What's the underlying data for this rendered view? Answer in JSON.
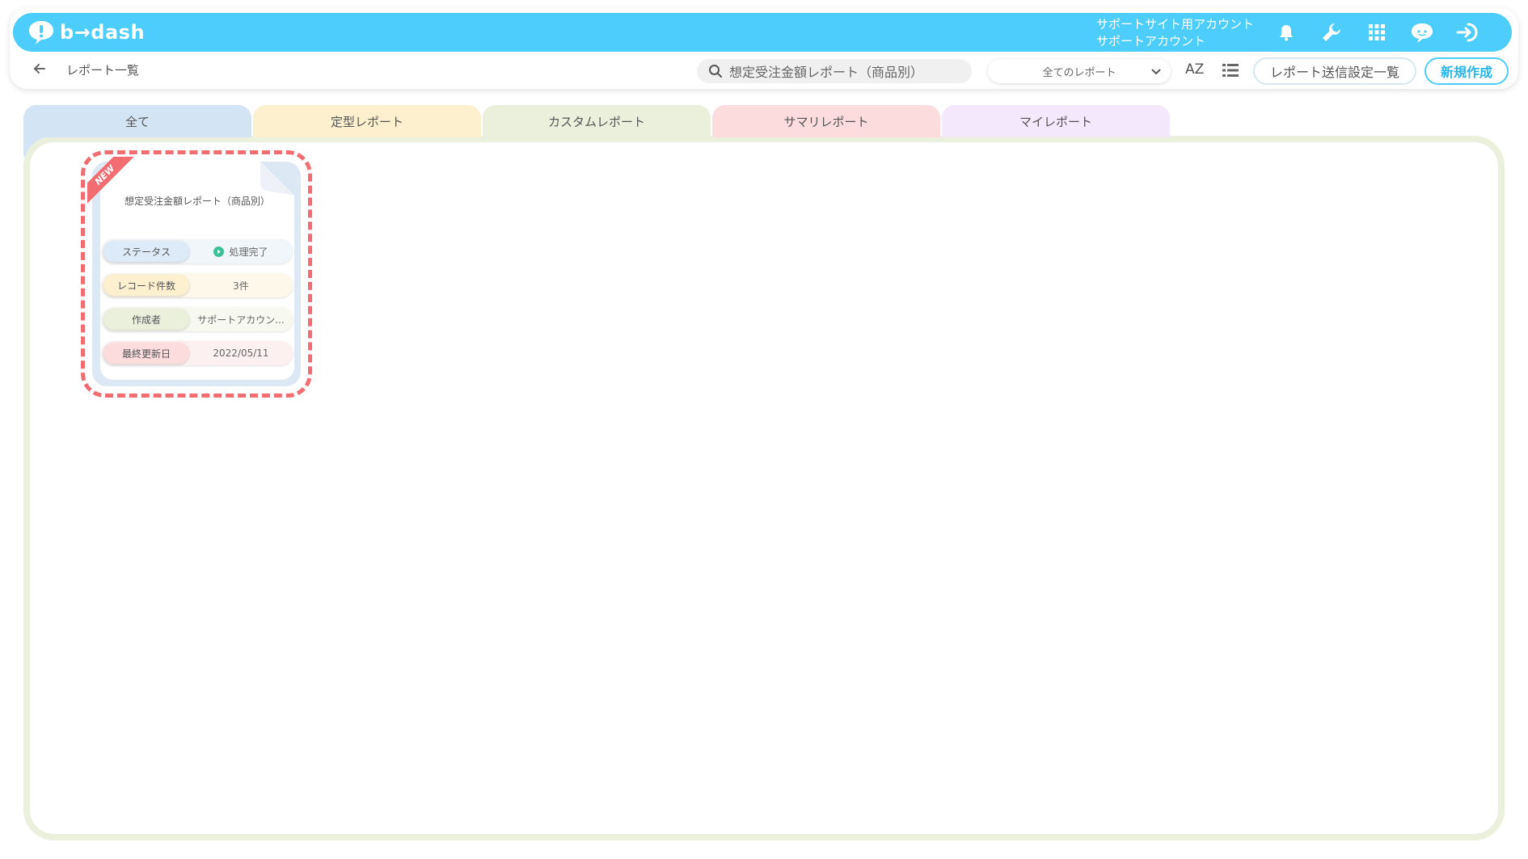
{
  "colors": {
    "brand": "#4ccdfc",
    "highlight_outline": "#f26d72",
    "status_ok": "#3fbf96",
    "tab_all": "#d3e5f4",
    "tab_standard": "#fcf0cf",
    "tab_custom": "#ebf0dc",
    "tab_summary": "#fcdcdc",
    "tab_my": "#f4e8fc"
  },
  "header": {
    "logo": "b→dash",
    "account_line1": "サポートサイト用アカウント",
    "account_line2": "サポートアカウント",
    "icons": [
      "bell-icon",
      "wrench-icon",
      "apps-grid-icon",
      "chat-bot-icon",
      "logout-icon"
    ]
  },
  "toolbar": {
    "breadcrumb": "レポート一覧",
    "search_value": "想定受注金額レポート（商品別）",
    "filter_selected": "全てのレポート",
    "sort_label": "AZ",
    "send_settings_label": "レポート送信設定一覧",
    "new_label": "新規作成"
  },
  "tabs": [
    {
      "label": "全て"
    },
    {
      "label": "定型レポート"
    },
    {
      "label": "カスタムレポート"
    },
    {
      "label": "サマリレポート"
    },
    {
      "label": "マイレポート"
    }
  ],
  "report_card": {
    "badge": "NEW",
    "title": "想定受注金額レポート（商品別）",
    "rows": [
      {
        "key": "ステータス",
        "value": "処理完了"
      },
      {
        "key": "レコード件数",
        "value": "3件"
      },
      {
        "key": "作成者",
        "value": "サポートアカウン..."
      },
      {
        "key": "最終更新日",
        "value": "2022/05/11"
      }
    ]
  }
}
